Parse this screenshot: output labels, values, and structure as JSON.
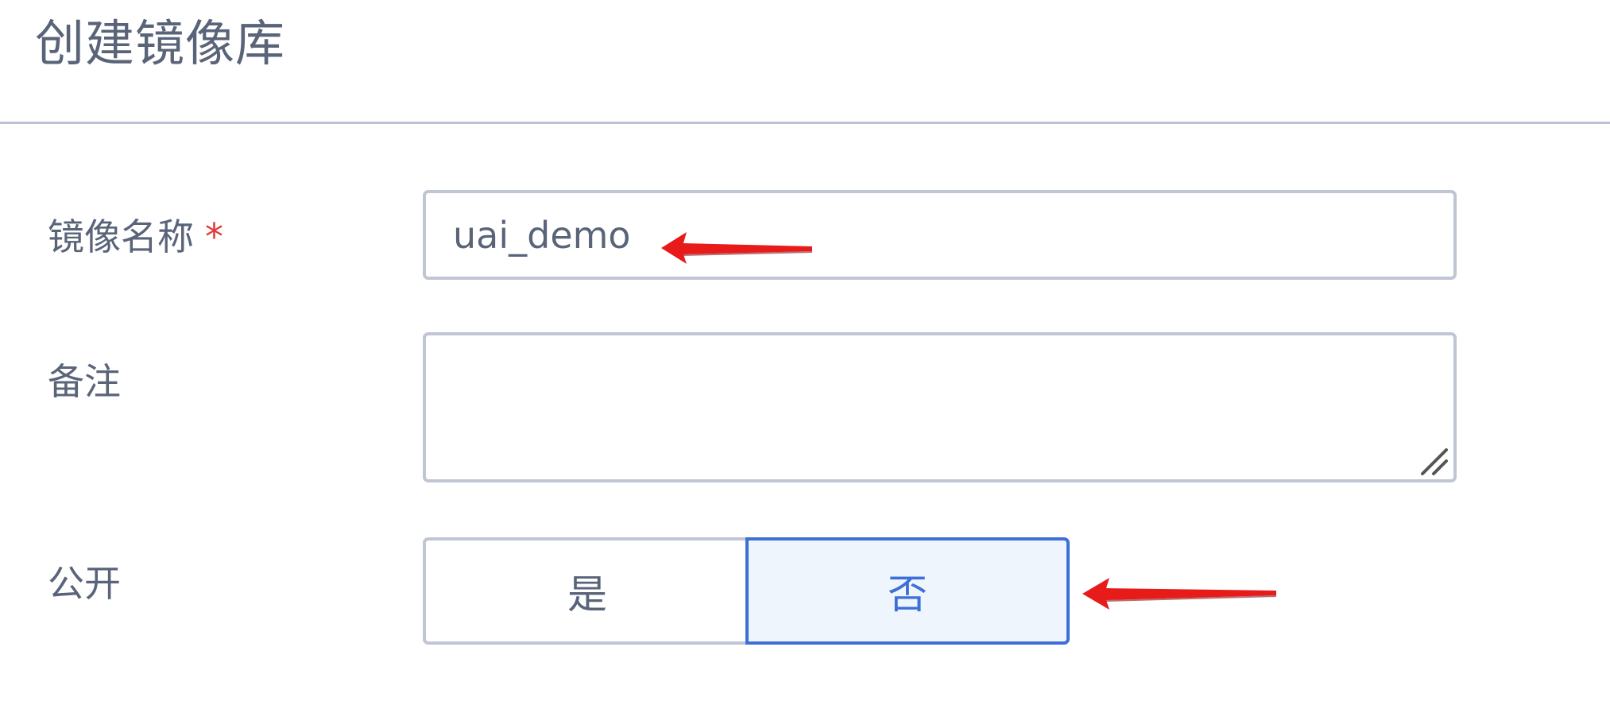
{
  "dialog": {
    "title": "创建镜像库"
  },
  "form": {
    "name": {
      "label": "镜像名称",
      "required_mark": "*",
      "value": "uai_demo"
    },
    "remark": {
      "label": "备注",
      "value": ""
    },
    "public": {
      "label": "公开",
      "options": [
        "是",
        "否"
      ],
      "selected": "否"
    }
  },
  "colors": {
    "text": "#5a6479",
    "border": "#c0c5d3",
    "accent": "#3d6fd9",
    "selected_bg": "#eef5fd",
    "required": "#e23b3b",
    "annotation": "#e81b1b"
  },
  "icons": {
    "resize_handle": "resize-handle-icon",
    "annotation": "red-arrow-icon"
  }
}
